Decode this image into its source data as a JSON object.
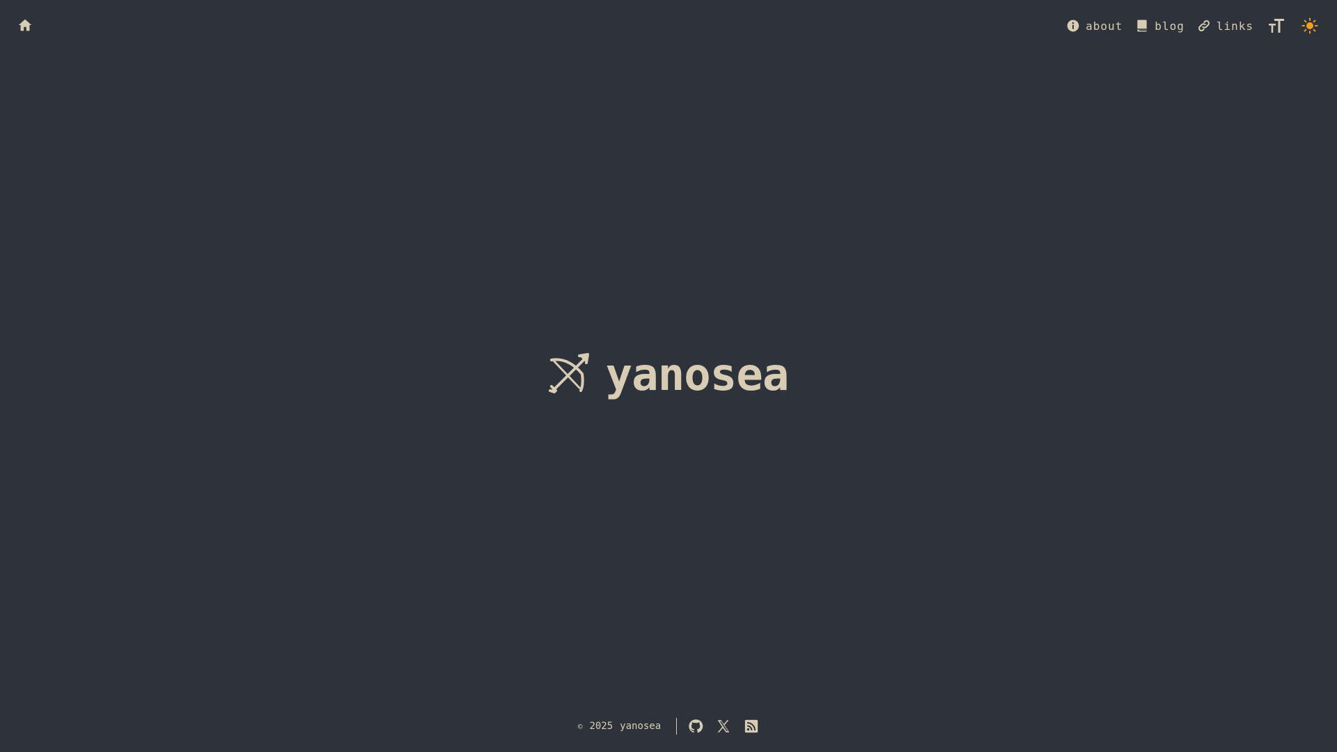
{
  "header": {
    "home_icon": "home-icon",
    "nav": [
      {
        "label": "about",
        "icon": "info-icon"
      },
      {
        "label": "blog",
        "icon": "book-icon"
      },
      {
        "label": "links",
        "icon": "link-icon"
      }
    ],
    "font_size_icon": "text-size-icon",
    "theme_icon": "sun-icon"
  },
  "hero": {
    "logo_icon": "bow-arrow-icon",
    "title": "yanosea"
  },
  "footer": {
    "copyright_symbol": "©",
    "year": "2025",
    "owner": "yanosea",
    "social": [
      {
        "icon": "github-icon"
      },
      {
        "icon": "x-icon"
      },
      {
        "icon": "rss-icon"
      }
    ]
  },
  "colors": {
    "background": "#2e333b",
    "foreground": "#d8cdb4",
    "accent": "#f0a020"
  }
}
